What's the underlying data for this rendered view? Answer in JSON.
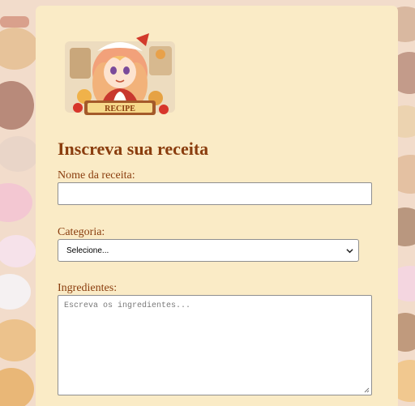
{
  "form": {
    "title": "Inscreva sua receita",
    "mascot_badge": "RECIPE",
    "recipe_name_label": "Nome da receita:",
    "recipe_name_value": "",
    "category_label": "Categoria:",
    "category_selected": "Selecione...",
    "ingredients_label": "Ingredientes:",
    "ingredients_placeholder": "Escreva os ingredientes..."
  },
  "colors": {
    "panel_background": "#faebc6",
    "heading_brown": "#8a3d0e"
  },
  "icons": {
    "select_arrow": "chevron-down-icon",
    "textarea_resize": "resize-handle-icon"
  }
}
